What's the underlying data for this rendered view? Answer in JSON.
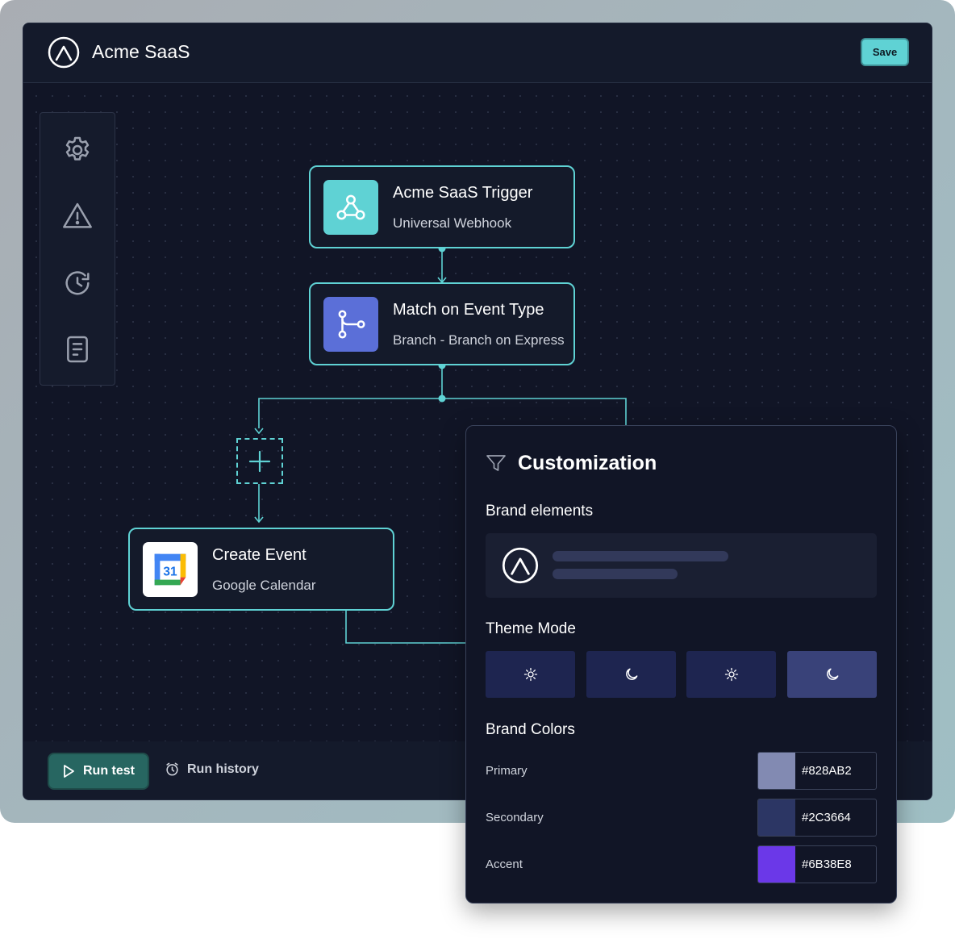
{
  "app": {
    "title": "Acme SaaS",
    "save_label": "Save"
  },
  "toolbar": {
    "items": [
      {
        "name": "settings",
        "icon": "gear-icon"
      },
      {
        "name": "warnings",
        "icon": "warning-icon"
      },
      {
        "name": "history",
        "icon": "history-icon"
      },
      {
        "name": "logs",
        "icon": "document-icon"
      }
    ]
  },
  "nodes": {
    "trigger": {
      "title": "Acme SaaS Trigger",
      "subtitle": "Universal Webhook",
      "icon": "webhook-icon",
      "color": "#5fd2d4"
    },
    "branch": {
      "title": "Match on Event Type",
      "subtitle": "Branch - Branch on Express",
      "icon": "branch-icon",
      "color": "#5b6fd8"
    },
    "event": {
      "title": "Create Event",
      "subtitle": "Google Calendar",
      "icon": "google-calendar-icon",
      "calendar_day": "31"
    }
  },
  "bottom_bar": {
    "run_test_label": "Run test",
    "run_history_label": "Run history"
  },
  "customization": {
    "title": "Customization",
    "brand_elements_label": "Brand elements",
    "theme_mode_label": "Theme Mode",
    "theme_modes": [
      {
        "icon": "sun-icon",
        "selected": false
      },
      {
        "icon": "moon-icon",
        "selected": false
      },
      {
        "icon": "sun-icon",
        "selected": false
      },
      {
        "icon": "moon-icon",
        "selected": true
      }
    ],
    "brand_colors_label": "Brand Colors",
    "colors": [
      {
        "label": "Primary",
        "hex": "#828AB2"
      },
      {
        "label": "Secondary",
        "hex": "#2C3664"
      },
      {
        "label": "Accent",
        "hex": "#6B38E8"
      }
    ]
  },
  "theme": {
    "accent": "#5fd2d4",
    "background": "#111526"
  }
}
